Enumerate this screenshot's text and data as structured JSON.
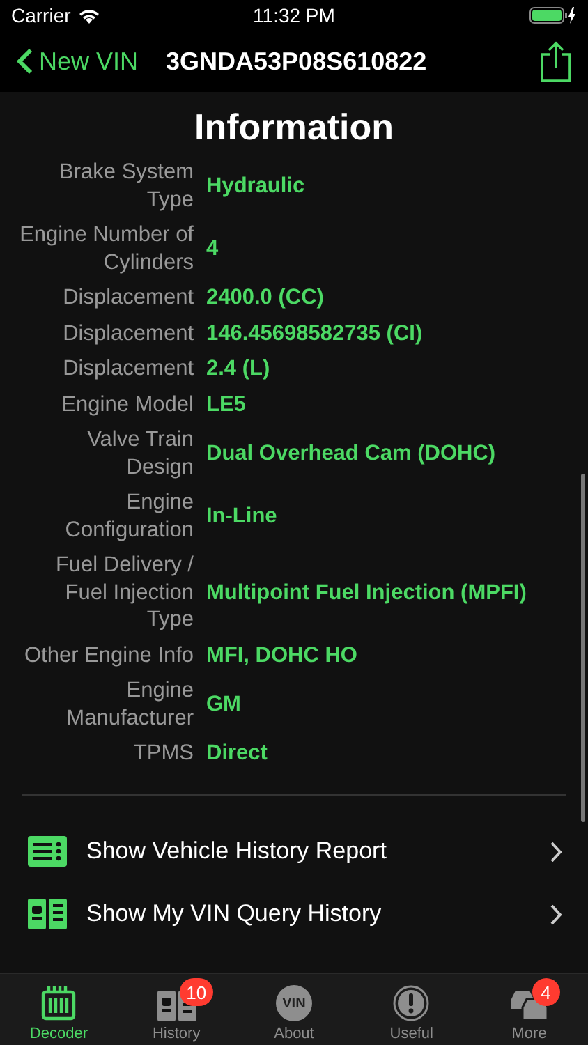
{
  "status_bar": {
    "carrier": "Carrier",
    "time": "11:32 PM"
  },
  "nav": {
    "back": "New VIN",
    "title": "3GNDA53P08S610822"
  },
  "section_title": "Information",
  "rows": [
    {
      "label": "Brake System Type",
      "value": "Hydraulic"
    },
    {
      "label": "Engine Number of Cylinders",
      "value": "4"
    },
    {
      "label": "Displacement",
      "value": "2400.0 (CC)"
    },
    {
      "label": "Displacement",
      "value": "146.45698582735 (CI)"
    },
    {
      "label": "Displacement",
      "value": "2.4 (L)"
    },
    {
      "label": "Engine Model",
      "value": "LE5"
    },
    {
      "label": "Valve Train Design",
      "value": "Dual Overhead Cam (DOHC)"
    },
    {
      "label": "Engine Configuration",
      "value": "In-Line"
    },
    {
      "label": "Fuel Delivery / Fuel Injection Type",
      "value": "Multipoint Fuel Injection (MPFI)"
    },
    {
      "label": "Other Engine Info",
      "value": "MFI, DOHC HO"
    },
    {
      "label": "Engine Manufacturer",
      "value": "GM"
    },
    {
      "label": "TPMS",
      "value": "Direct"
    }
  ],
  "actions": [
    {
      "kind": "report",
      "label": "Show Vehicle History Report"
    },
    {
      "kind": "history",
      "label": "Show My VIN Query History"
    }
  ],
  "tabs": [
    {
      "kind": "decoder",
      "label": "Decoder",
      "selected": true
    },
    {
      "kind": "history",
      "label": "History",
      "selected": false,
      "badge": "10"
    },
    {
      "kind": "about",
      "label": "About",
      "selected": false,
      "icon_text": "VIN"
    },
    {
      "kind": "useful",
      "label": "Useful",
      "selected": false
    },
    {
      "kind": "more",
      "label": "More",
      "selected": false,
      "badge": "4"
    }
  ]
}
